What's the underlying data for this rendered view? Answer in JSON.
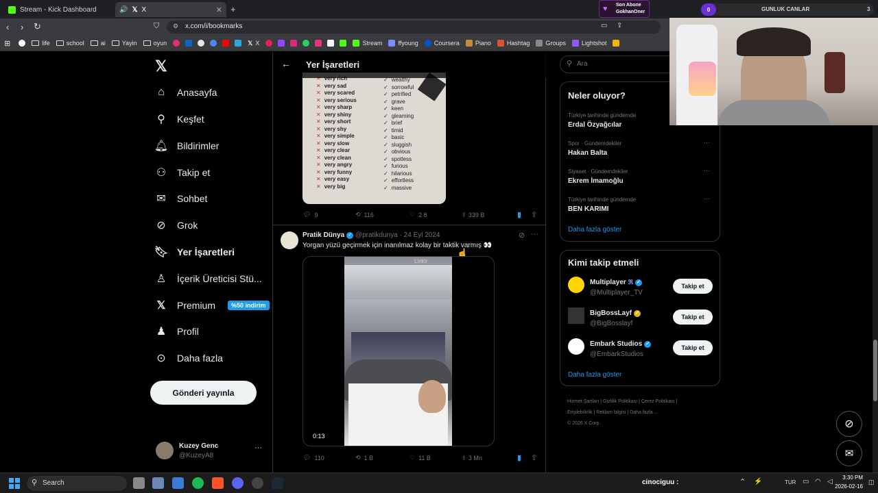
{
  "browser": {
    "tabs": [
      {
        "title": "Stream - Kick Dashboard",
        "color": "#53fc18"
      },
      {
        "title": "X",
        "color": "#ffffff"
      }
    ],
    "new_tab": "+",
    "url": "x.com/i/bookmarks",
    "bookmarks": [
      {
        "label": "",
        "icon": "google"
      },
      {
        "label": "life",
        "icon": "folder"
      },
      {
        "label": "school",
        "icon": "folder"
      },
      {
        "label": "ai",
        "icon": "folder"
      },
      {
        "label": "Yayin",
        "icon": "folder"
      },
      {
        "label": "oyun",
        "icon": "folder"
      },
      {
        "label": "X",
        "icon": "x"
      },
      {
        "label": "Stream",
        "icon": "kick"
      },
      {
        "label": "ffyoung",
        "icon": "link"
      },
      {
        "label": "Coursera",
        "icon": "coursera"
      },
      {
        "label": "Piano",
        "icon": "piano"
      },
      {
        "label": "Hashtag",
        "icon": "link"
      },
      {
        "label": "Groups",
        "icon": "link"
      },
      {
        "label": "Lightshot",
        "icon": "feather"
      }
    ]
  },
  "sidebar": {
    "items": [
      {
        "label": "Anasayfa",
        "icon": "home-icon"
      },
      {
        "label": "Keşfet",
        "icon": "search-icon"
      },
      {
        "label": "Bildirimler",
        "icon": "bell-icon"
      },
      {
        "label": "Takip et",
        "icon": "add-person-icon"
      },
      {
        "label": "Sohbet",
        "icon": "mail-icon"
      },
      {
        "label": "Grok",
        "icon": "grok-icon"
      },
      {
        "label": "Yer İşaretleri",
        "icon": "bookmark-icon"
      },
      {
        "label": "İçerik Üreticisi Stü...",
        "icon": "creator-icon"
      },
      {
        "label": "Premium",
        "icon": "x-premium-icon"
      },
      {
        "label": "Profil",
        "icon": "person-icon"
      },
      {
        "label": "Daha fazla",
        "icon": "more-circle-icon"
      }
    ],
    "premium_badge": "%50 indirim",
    "post_button": "Gönderi yayınla",
    "user": {
      "name": "Kuzey Genc",
      "handle": "@KuzeyA8"
    }
  },
  "feed": {
    "header_title": "Yer İşaretleri",
    "post1": {
      "image_left": [
        "very rich",
        "very sad",
        "very scared",
        "very serious",
        "very sharp",
        "very shiny",
        "very short",
        "very shy",
        "very simple",
        "very slow",
        "very clear",
        "very clean",
        "very angry",
        "very funny",
        "very easy",
        "very big"
      ],
      "image_right": [
        "wealthy",
        "sorrowful",
        "petrified",
        "grave",
        "keen",
        "gleaming",
        "brief",
        "timid",
        "basic",
        "sluggish",
        "obvious",
        "spotless",
        "furious",
        "hilarious",
        "effortless",
        "massive"
      ],
      "replies": "9",
      "reposts": "116",
      "likes": "2 8",
      "views": "339 B"
    },
    "post2": {
      "author": "Pratik Dünya",
      "handle": "@pratikdunya",
      "date": "· 24 Eyl 2024",
      "text": "Yorgan yüzü geçirmek için inanılmaz kolay bir taktik varmış 👀",
      "video_duration": "0:13",
      "video_watermark": "Linktr",
      "replies": "110",
      "reposts": "1 B",
      "likes": "11 B",
      "views": "3 Mn"
    }
  },
  "right": {
    "search_placeholder": "Ara",
    "trends_title": "Neler oluyor?",
    "trends": [
      {
        "meta": "Türkiye tarihinde gündemde",
        "name": "Erdal Özyağcılar"
      },
      {
        "meta": "Spor · Gündemdekiler",
        "name": "Hakan Balta"
      },
      {
        "meta": "Siyaset · Gündemdekiler",
        "name": "Ekrem İmamoğlu"
      },
      {
        "meta": "Türkiye tarihinde gündemde",
        "name": "BEN KARIMI"
      }
    ],
    "show_more": "Daha fazla göster",
    "follow_title": "Kimi takip etmeli",
    "follow": [
      {
        "name": "Multiplayer",
        "handle": "@Multiplayer_TV",
        "badge": "blue"
      },
      {
        "name": "BigBossLayf",
        "handle": "@BigBosslayf",
        "badge": "gold"
      },
      {
        "name": "Embark Studios",
        "handle": "@EmbarkStudios",
        "badge": "blue"
      }
    ],
    "follow_button": "Takip et",
    "show_more2": "Daha fazla göster",
    "footer": [
      "Hizmet Şartları",
      "Gizlilik Politikası",
      "Çerez Politikası",
      "Erişilebilirlik",
      "Reklam bilgisi",
      "Daha fazla ...",
      "© 2026 X Corp."
    ]
  },
  "overlay": {
    "sub_label": "Son Abone",
    "sub_name": "GokhanOner",
    "daily_label": "GUNLUK CANLAR",
    "daily_left": "0",
    "daily_right": "3"
  },
  "taskbar": {
    "search": "Search",
    "chat_name": "cinociguu :",
    "lang": "TUR",
    "time": "3:30 PM",
    "date": "2026-02-16"
  }
}
